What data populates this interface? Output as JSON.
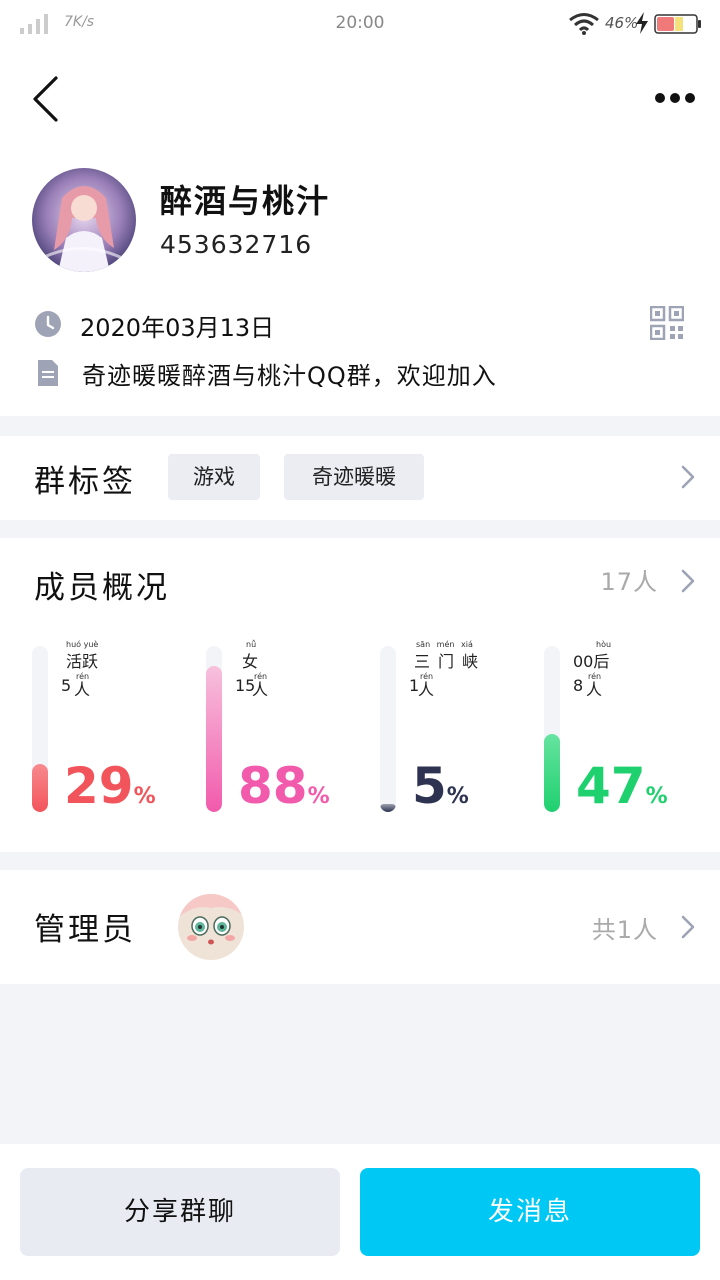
{
  "status_bar": {
    "speed": "7K/s",
    "time": "20:00",
    "battery_percent": "46%",
    "battery_level": 0.46
  },
  "header": {
    "back_icon": "chevron-left-icon",
    "more_icon": "more-dots-icon"
  },
  "group": {
    "name": "醉酒与桃汁",
    "id": "453632716",
    "created_date": "2020年03月13日",
    "description": "奇迹暖暖醉酒与桃汁QQ群，欢迎加入"
  },
  "tags_section": {
    "title": "群标签",
    "tags": [
      "游戏",
      "奇迹暖暖"
    ]
  },
  "members_section": {
    "title": "成员概况",
    "count": "17人",
    "stats": [
      {
        "label": "活跃",
        "pinyin": "huó yuè",
        "count": "5",
        "unit": "人",
        "unit_pinyin": "rén",
        "percent": "29",
        "percent_sign": "%",
        "fill": 0.29,
        "color": "#f2545b",
        "color_light": "#f88a8e"
      },
      {
        "label": "女",
        "pinyin": "nǚ",
        "count": "15",
        "unit": "人",
        "unit_pinyin": "rén",
        "percent": "88",
        "percent_sign": "%",
        "fill": 0.88,
        "color": "#f25aac",
        "color_light": "#f7c1dd"
      },
      {
        "label": "三门峡",
        "pinyin": "sān mén xiá",
        "count": "1",
        "unit": "人",
        "unit_pinyin": "rén",
        "percent": "5",
        "percent_sign": "%",
        "fill": 0.05,
        "color": "#2d3350",
        "color_light": "#9ca0b0"
      },
      {
        "label": "00后",
        "pinyin": "hòu",
        "count": "8",
        "unit": "人",
        "unit_pinyin": "rén",
        "percent": "47",
        "percent_sign": "%",
        "fill": 0.47,
        "color": "#1fd06f",
        "color_light": "#66e3a0"
      }
    ]
  },
  "admin_section": {
    "title": "管理员",
    "count": "共1人"
  },
  "bottom_bar": {
    "share_label": "分享群聊",
    "message_label": "发消息"
  }
}
